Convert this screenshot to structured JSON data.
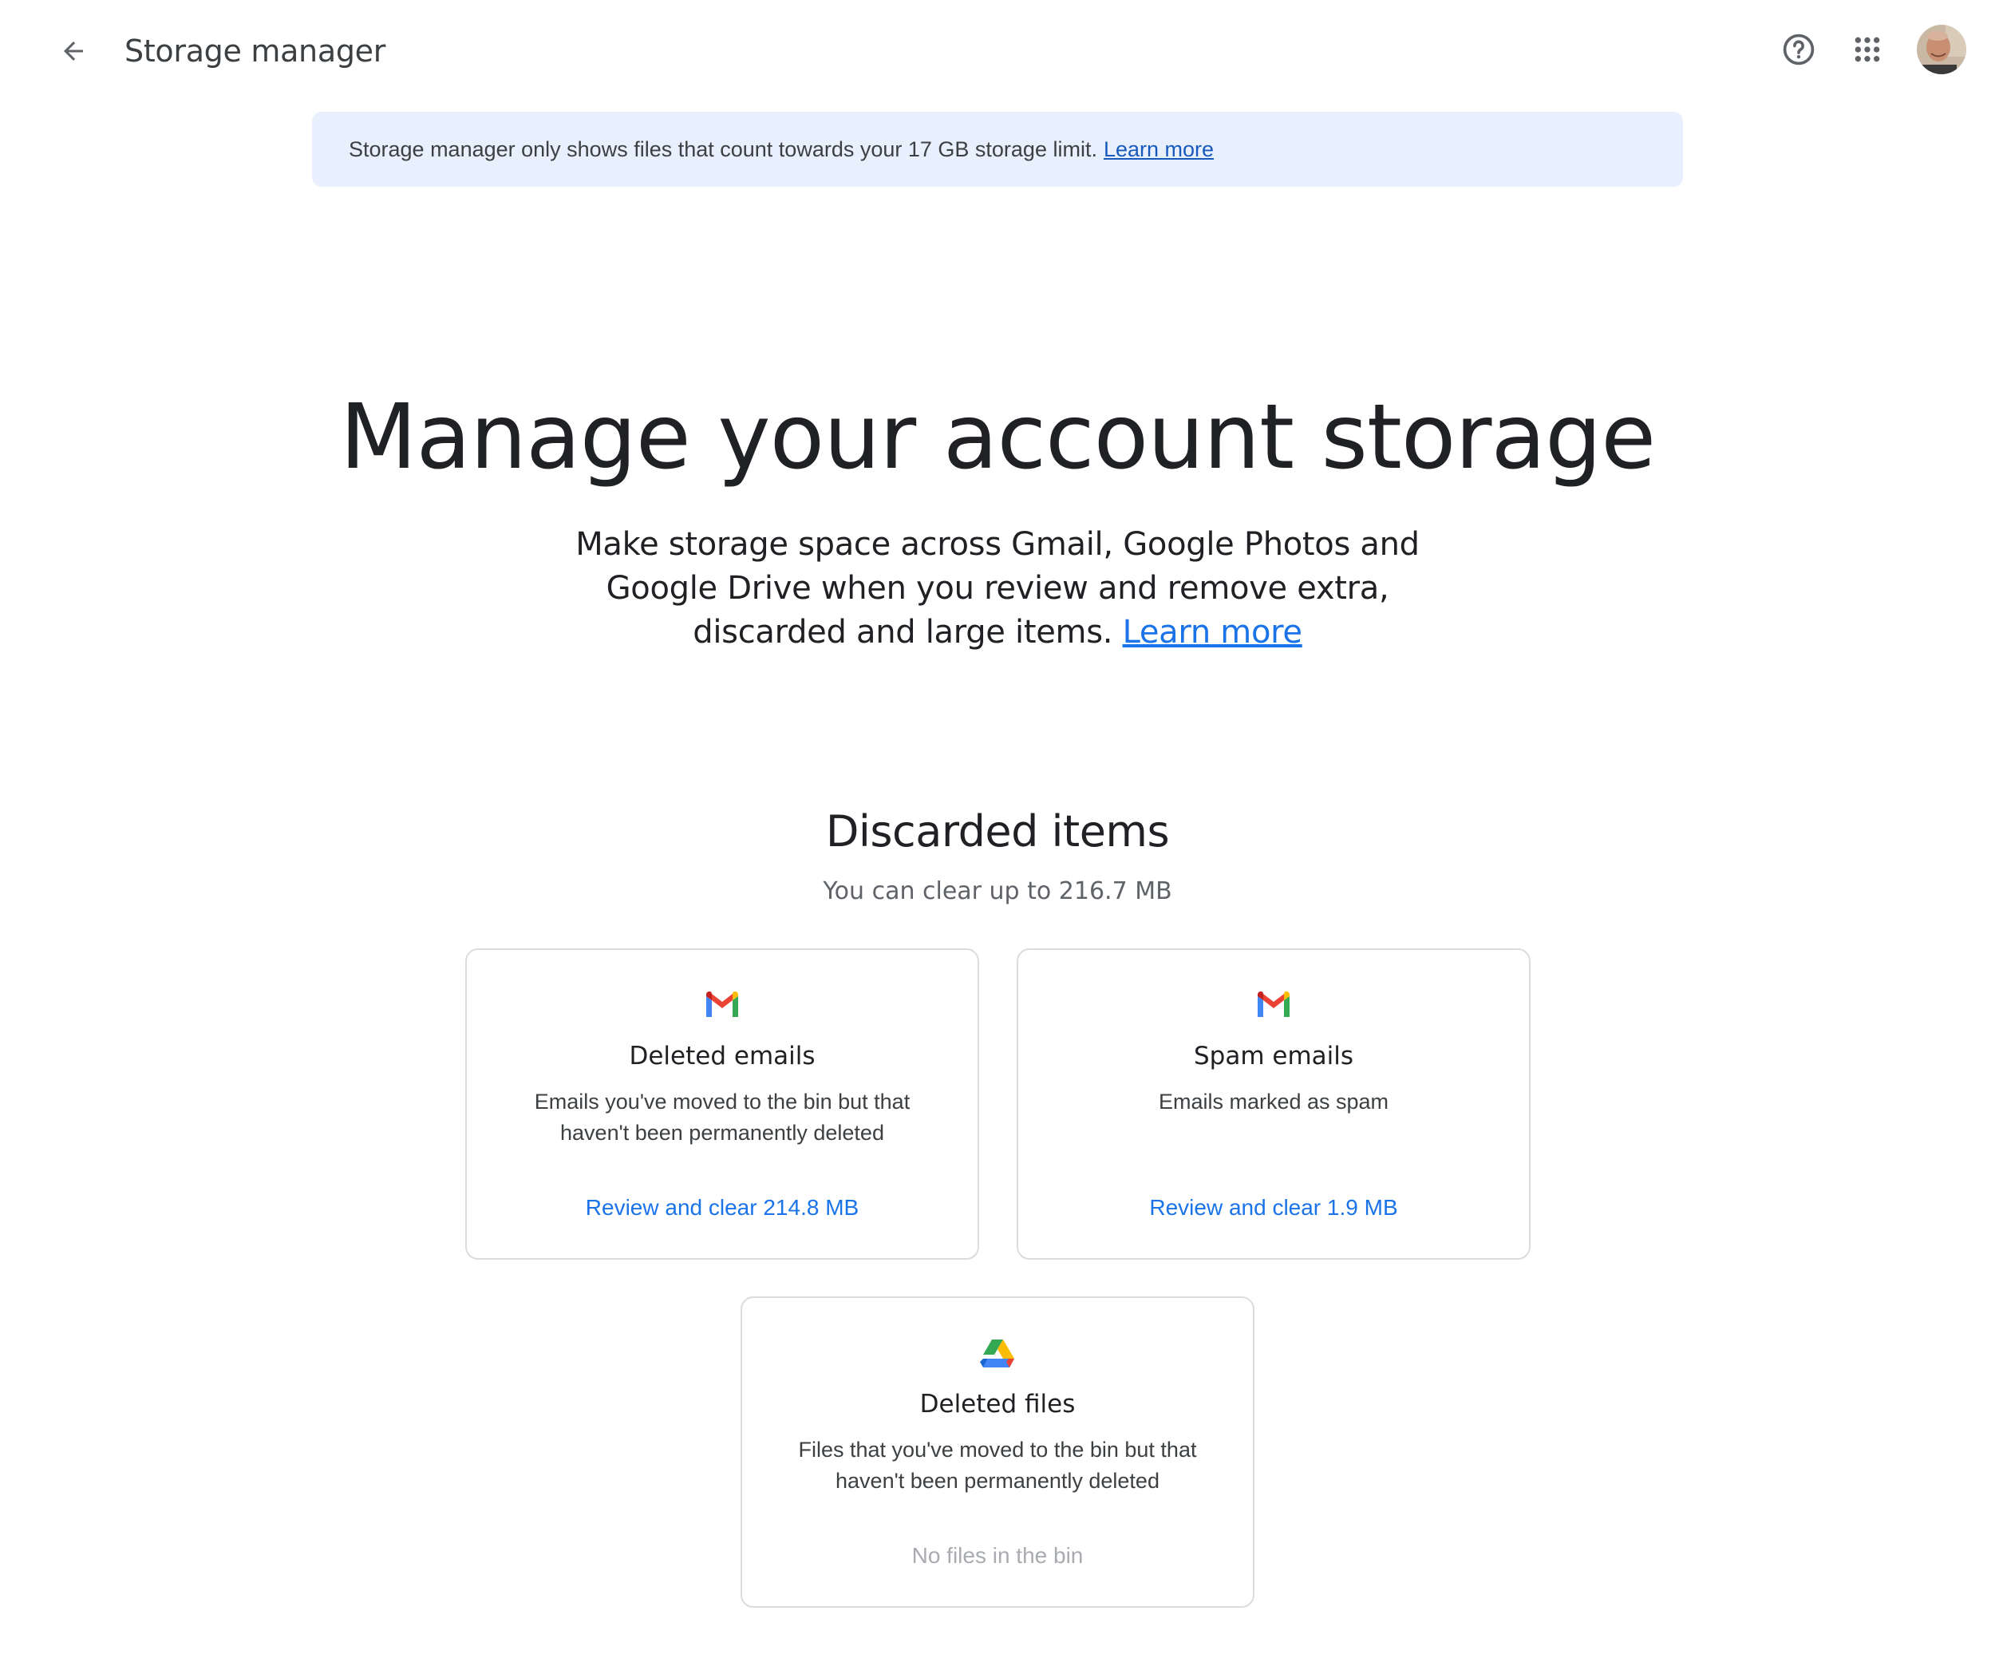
{
  "header": {
    "title": "Storage manager",
    "back_icon": "arrow-back-icon",
    "help_icon": "help-circle-icon",
    "apps_icon": "apps-grid-icon",
    "avatar": "user-avatar"
  },
  "banner": {
    "text": "Storage manager only shows files that count towards your 17 GB storage limit.",
    "link": "Learn more",
    "background": "#e8f0fe"
  },
  "hero": {
    "title": "Manage your account storage",
    "subtitle": "Make storage space across Gmail, Google Photos and Google Drive when you review and remove extra, discarded and large items.",
    "link": "Learn more"
  },
  "discarded": {
    "title": "Discarded items",
    "subtitle": "You can clear up to 216.7 MB",
    "cards": [
      {
        "icon": "gmail-icon",
        "title": "Deleted emails",
        "description": "Emails you've moved to the bin but that haven't been permanently deleted",
        "action": "Review and clear 214.8 MB"
      },
      {
        "icon": "gmail-icon",
        "title": "Spam emails",
        "description": "Emails marked as spam",
        "action": "Review and clear 1.9 MB"
      },
      {
        "icon": "google-drive-icon",
        "title": "Deleted files",
        "description": "Files that you've moved to the bin but that haven't been permanently deleted",
        "action": "No files in the bin"
      }
    ]
  },
  "colors": {
    "accent": "#1a73e8",
    "text_primary": "#202124",
    "text_secondary": "#5f6368",
    "disabled": "#a8abaf",
    "card_border": "#dadce0"
  }
}
